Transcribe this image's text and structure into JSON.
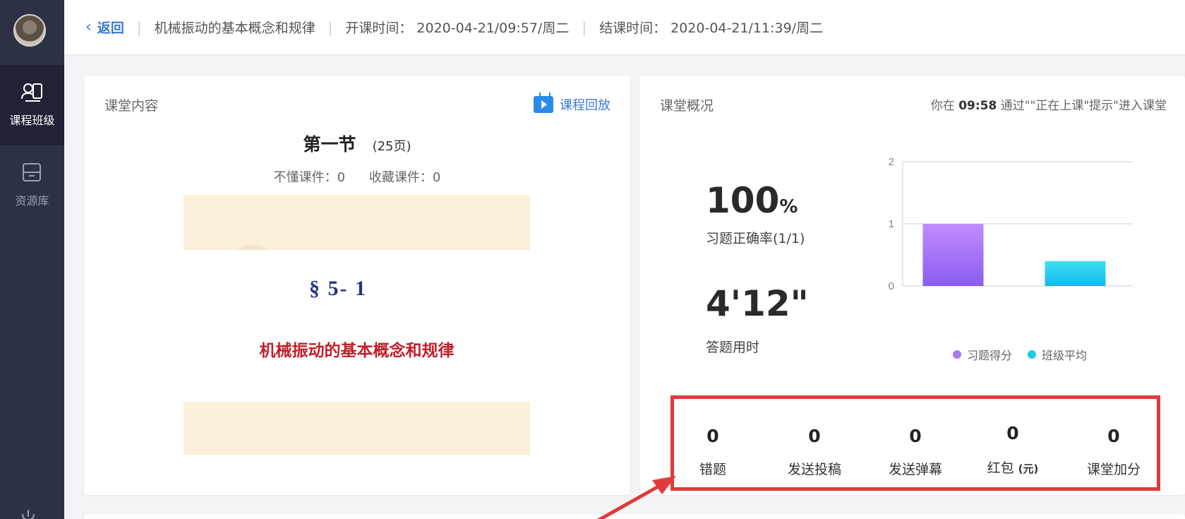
{
  "sidebar": {
    "items": [
      {
        "label": "课程班级",
        "icon": "class-icon",
        "active": true
      },
      {
        "label": "资源库",
        "icon": "library-icon",
        "active": false
      }
    ]
  },
  "header": {
    "back_label": "返回",
    "course_title": "机械振动的基本概念和规律",
    "start_label": "开课时间：",
    "start_time": "2020-04-21/09:57/周二",
    "end_label": "结课时间：",
    "end_time": "2020-04-21/11:39/周二"
  },
  "content_card": {
    "title": "课堂内容",
    "replay_label": "课程回放",
    "section": "第一节",
    "pages": "(25页)",
    "not_understood_label": "不懂课件：",
    "not_understood_value": "0",
    "favorited_label": "收藏课件：",
    "favorited_value": "0",
    "slide": {
      "number": "§ 5- 1",
      "text": "机械振动的基本概念和规律"
    }
  },
  "overview_card": {
    "title": "课堂概况",
    "arrive_prefix": "你在",
    "arrive_time": "09:58",
    "arrive_suffix": "通过\"\"正在上课\"提示\"进入课堂",
    "accuracy_value": "100",
    "accuracy_unit": "%",
    "accuracy_label": "习题正确率(1/1)",
    "duration_value": "4'12\"",
    "duration_label": "答题用时",
    "legend": [
      "习题得分",
      "班级平均"
    ],
    "stats": [
      {
        "value": "0",
        "label": "错题"
      },
      {
        "value": "0",
        "label": "发送投稿"
      },
      {
        "value": "0",
        "label": "发送弹幕"
      },
      {
        "value": "0",
        "label": "红包",
        "unit": "(元)"
      },
      {
        "value": "0",
        "label": "课堂加分"
      }
    ]
  },
  "chart_data": {
    "type": "bar",
    "categories": [
      "习题得分",
      "班级平均"
    ],
    "values": [
      1,
      0.4
    ],
    "ylim": [
      0,
      2
    ],
    "yticks": [
      "0",
      "1",
      "2"
    ],
    "colors": [
      "#9b6cf2",
      "#1fcbe8"
    ],
    "grid": true,
    "legend": "bottom"
  }
}
